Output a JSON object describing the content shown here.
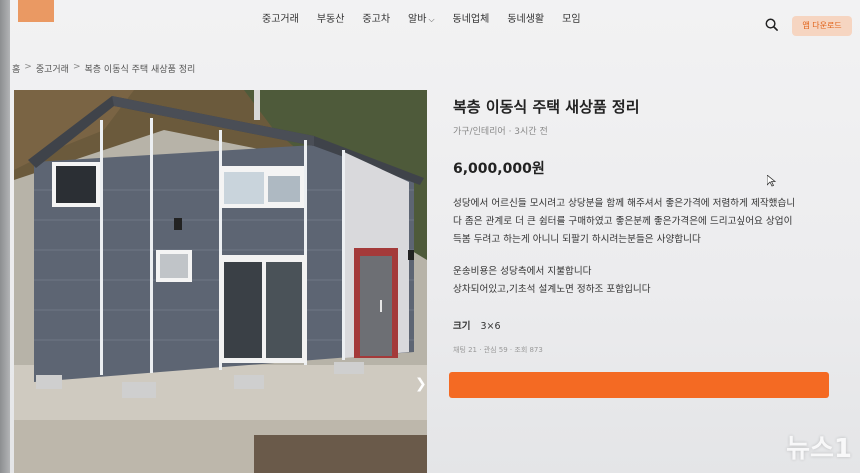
{
  "header": {
    "nav": [
      "중고거래",
      "부동산",
      "중고차",
      "알바",
      "동네업체",
      "동네생활",
      "모임"
    ],
    "app_download": "앱 다운로드"
  },
  "breadcrumb": [
    "홈",
    "중고거래",
    "복층 이동식 주택 새상품 정리"
  ],
  "listing": {
    "title": "복층 이동식 주택 새상품 정리",
    "category_time": "가구/인테리어 · 3시간 전",
    "price": "6,000,000원",
    "description": [
      "성당에서 어르신들 모시려고 상당분을 함께 해주셔서 좋은가격에 저렴하게 제작했습니",
      "다 좀은 관계로 더 큰 쉼터를 구매하였고 좋은분께 좋은가격은에 드리고싶어요 상업이",
      "득봄 두려고 하는게 아니니 되팔기 하시려는분들은 사양합니다"
    ],
    "shipping": [
      "운송비용은 성당측에서 지불합니다",
      "상차되어있고,기초석 설계노면 정하조 포함입니다"
    ],
    "size_label": "크기",
    "size_value": "3×6",
    "stats": "채팅 21 · 관심 59 · 조회 873"
  },
  "watermark": "뉴스1",
  "colors": {
    "accent": "#f46a23",
    "app_button_bg": "#f6d5c1",
    "app_button_text": "#e05f14"
  }
}
